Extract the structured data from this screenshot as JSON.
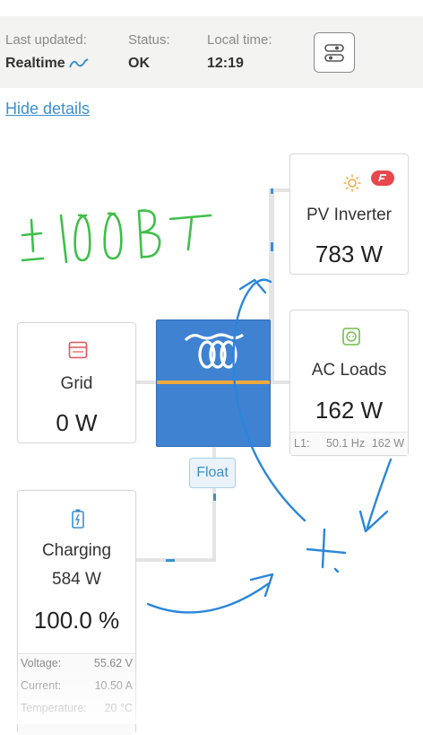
{
  "header": {
    "last_updated_label": "Last updated:",
    "last_updated_value": "Realtime",
    "status_label": "Status:",
    "status_value": "OK",
    "local_time_label": "Local time:",
    "local_time_value": "12:19"
  },
  "hide_details": "Hide details",
  "pv_inverter": {
    "title": "PV Inverter",
    "value": "783 W",
    "badge_color": "#e8474c"
  },
  "ac_loads": {
    "title": "AC Loads",
    "value": "162 W",
    "phase": "L1:",
    "freq": "50.1 Hz",
    "power": "162 W"
  },
  "grid": {
    "title": "Grid",
    "value": "0 W"
  },
  "inverter": {
    "state": "Float",
    "bar_color": "#f2a93b",
    "body_color": "#3f82d2"
  },
  "battery": {
    "title": "Charging",
    "power": "584 W",
    "soc": "100.0 %",
    "details": [
      {
        "label": "Voltage:",
        "value": "55.62 V"
      },
      {
        "label": "Current:",
        "value": "10.50 A"
      },
      {
        "label": "Temperature:",
        "value": "20 °C"
      }
    ]
  },
  "colors": {
    "accent": "#3b8fd0",
    "grid_icon": "#e05656",
    "loads_icon": "#6fbf4a",
    "solar_icon": "#f2a93b",
    "handwriting_green": "#3fbf4a",
    "handwriting_blue": "#2a86d9"
  },
  "icons": [
    "realtime-wave-icon",
    "toggle-icon",
    "sun-icon",
    "fronius-logo-icon",
    "grid-icon",
    "outlet-icon",
    "battery-icon",
    "victron-logo-icon"
  ]
}
